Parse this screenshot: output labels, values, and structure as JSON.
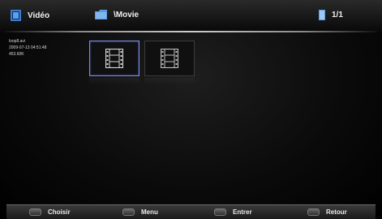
{
  "header": {
    "section_label": "Vidéo",
    "section_icon": "video-icon",
    "path": "\\Movie",
    "path_icon": "folder-icon",
    "page_indicator": "1/1",
    "page_icon": "page-icon"
  },
  "file_info": {
    "name": "loop8.avi",
    "date": "2009-07-13 04:51:48",
    "size": "453.60K"
  },
  "thumbnails": [
    {
      "icon": "film-icon",
      "selected": true
    },
    {
      "icon": "film-icon",
      "selected": false
    }
  ],
  "footer": {
    "choose_label": "Choisir",
    "menu_label": "Menu",
    "enter_label": "Entrer",
    "back_label": "Retour"
  },
  "colors": {
    "selection_border": "#7f8ee0",
    "header_icon": "#4a8fd8"
  }
}
